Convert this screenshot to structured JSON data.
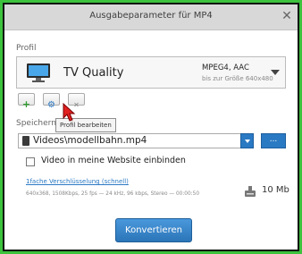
{
  "window": {
    "title": "Ausgabeparameter für MP4",
    "close_glyph": "✕"
  },
  "profile": {
    "section_label": "Profil",
    "name": "TV Quality",
    "format": "MPEG4, AAC",
    "resolution": "bis zur Größe 640x480",
    "icon": "tv-icon"
  },
  "profile_actions": {
    "add_glyph": "+",
    "settings_glyph": "⚙",
    "delete_glyph": "✕",
    "tooltip": "Profil bearbeiten"
  },
  "save": {
    "section_label": "Speichern",
    "path": "Videos\\modellbahn.mp4",
    "browse_label": "..."
  },
  "options": {
    "embed_label": "Video in meine Website einbinden",
    "embed_checked": false
  },
  "encoding": {
    "link": "1fache Verschlüsselung (schnell)",
    "details": "640x368, 1508Kbps, 25 fps — 24 kHz, 96 kbps, Stereo — 00:00:50",
    "size": "10 Mb"
  },
  "footer": {
    "convert_label": "Konvertieren"
  },
  "colors": {
    "accent": "#2a79c3",
    "green": "#2e9e2e",
    "frame_border": "#3cc23c"
  }
}
